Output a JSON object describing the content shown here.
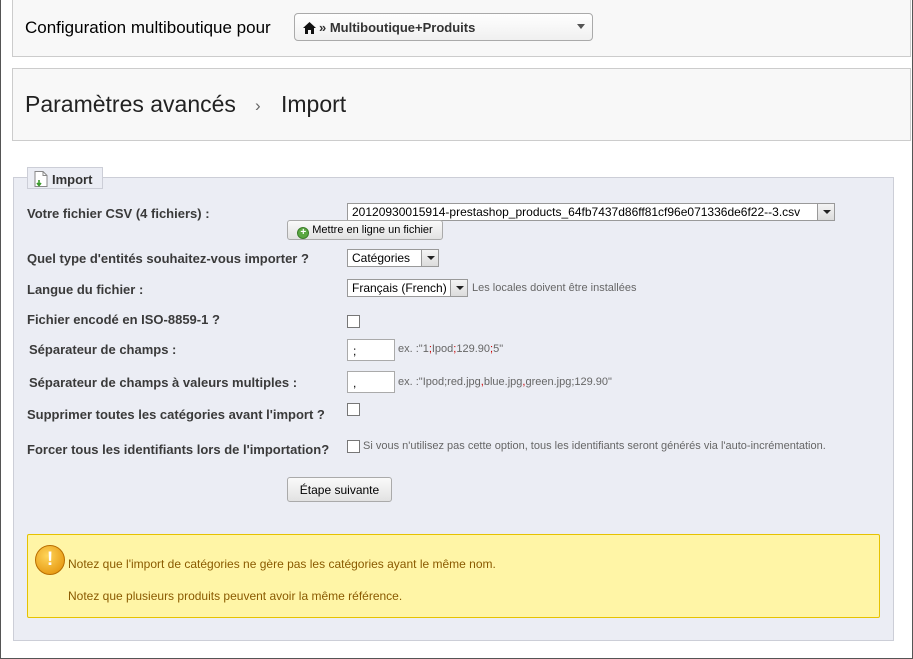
{
  "shopbar": {
    "label": "Configuration multiboutique pour",
    "selected": "» Multiboutique+Produits"
  },
  "header": {
    "breadcrumb": "Paramètres avancés",
    "separator": "›",
    "page_title": "Import"
  },
  "form": {
    "legend": "Import",
    "csv_label": "Votre fichier CSV (4 fichiers) :",
    "csv_file": "20120930015914-prestashop_products_64fb7437d86ff81cf96e071336de6f22--3.csv",
    "upload_button": "Mettre en ligne un fichier",
    "entity_label": "Quel type d'entités souhaitez-vous importer ?",
    "entity_value": "Catégories",
    "lang_label": "Langue du fichier :",
    "lang_value": "Français (French)",
    "lang_hint": "Les locales doivent être installées",
    "iso_label": "Fichier encodé en ISO-8859-1 ?",
    "sep_label": "Séparateur de champs :",
    "sep_value": ";",
    "sep_hint": {
      "a": "ex. :\"1",
      "b": ";",
      "c": "Ipod",
      "d": ";",
      "e": "129.90",
      "f": ";",
      "g": "5\""
    },
    "multi_sep_label": "Séparateur de champs à valeurs multiples :",
    "multi_sep_value": ",",
    "multi_sep_hint": {
      "a": "ex. :\"Ipod;red.jpg",
      "b": ",",
      "c": "blue.jpg",
      "d": ",",
      "e": "green.jpg;129.90\""
    },
    "truncate_label": "Supprimer toutes les catégories avant l'import ?",
    "force_ids_label": "Forcer tous les identifiants lors de l'importation?",
    "force_ids_hint": "Si vous n'utilisez pas cette option, tous les identifiants seront générés via l'auto-incrémentation.",
    "next_button": "Étape suivante"
  },
  "warning": {
    "icon": "!",
    "line1": "Notez que l'import de catégories ne gère pas les catégories ayant le même nom.",
    "line2": "Notez que plusieurs produits peuvent avoir la même référence."
  }
}
